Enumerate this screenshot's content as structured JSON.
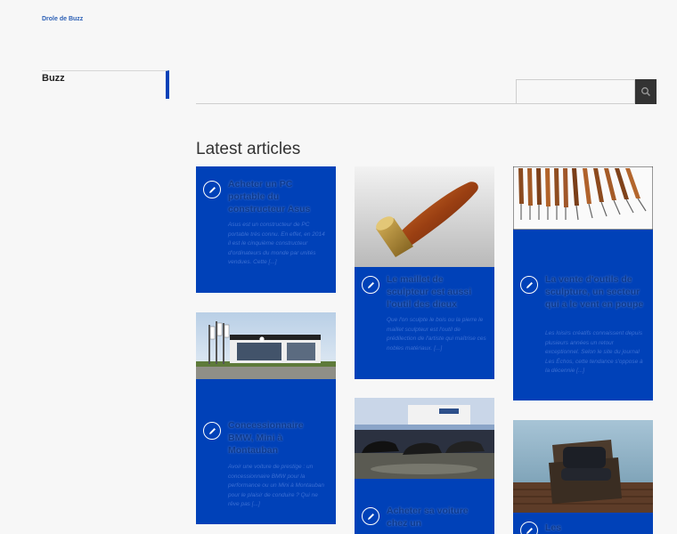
{
  "site": {
    "title": "Drole de Buzz"
  },
  "sidebar": {
    "items": [
      {
        "label": "Buzz"
      }
    ]
  },
  "search": {
    "value": "",
    "placeholder": ""
  },
  "main": {
    "section_title": "Latest articles",
    "articles": [
      {
        "title": "Acheter un PC portable du constructeur Asus",
        "excerpt": "Asus est un constructeur de PC portable très connu. En effet, en 2014 il est le cinquième constructeur d'ordinateurs du monde par unités vendues. Cette [...]",
        "icon": "pen-icon"
      },
      {
        "title": "Le maillet de sculpteur est aussi l'outil des dieux",
        "excerpt": "Que l'on sculpte le bois ou la pierre le maillet sculpteur est l'outil de prédilection de l'artiste qui maîtrise ces nobles matériaux. [...]",
        "icon": "pen-icon"
      },
      {
        "title": "La vente d'outils de sculpture, un secteur qui a le vent en poupe",
        "excerpt": "Les loisirs créatifs connaissent depuis plusieurs années un retour exceptionnel. Selon le site du journal Les Échos, cette tendance s'oppose à la décennie [...]",
        "icon": "pen-icon"
      },
      {
        "title": "Concessionnaire BMW, Mini à Montauban",
        "excerpt": "Avoir une voiture de prestige : un concessionnaire BMW pour la performance ou un Mini à Montauban pour le plaisir de conduire ? Qui ne rêve pas [...]",
        "icon": "pen-icon"
      },
      {
        "title": "Acheter sa voiture chez un",
        "excerpt": "",
        "icon": "pen-icon"
      },
      {
        "title": "Les",
        "excerpt": "",
        "icon": "pen-icon"
      }
    ]
  },
  "colors": {
    "accent": "#0041b8",
    "link": "#2b5fb5",
    "search_button": "#333333"
  }
}
